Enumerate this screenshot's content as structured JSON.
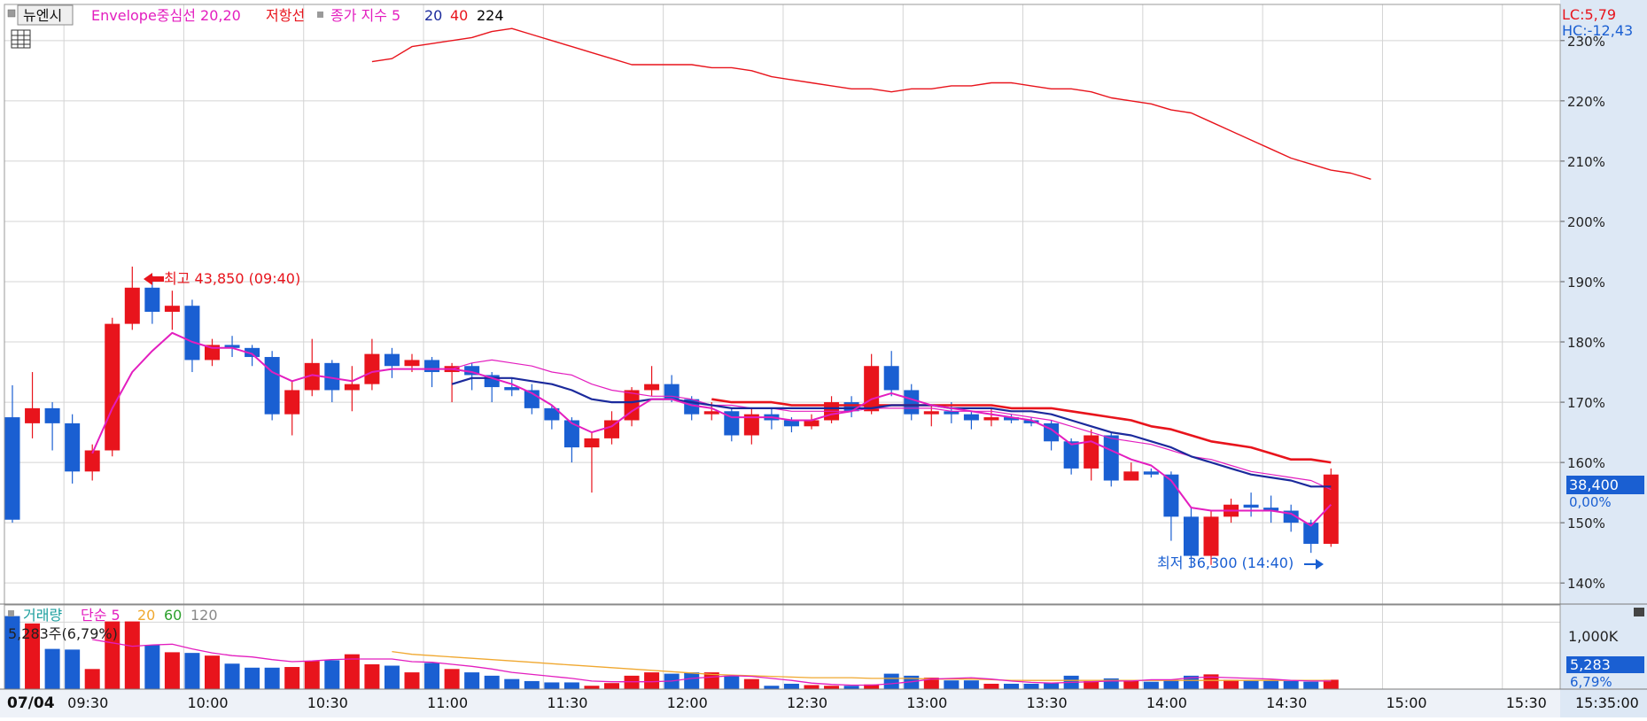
{
  "colors": {
    "up": "#e8141c",
    "down": "#1a5fd2",
    "envelope": "#e31ebf",
    "ma5": "#e31ebf",
    "ma20": "#1b2a9c",
    "ma40": "#e8141c",
    "ma224": "#000000",
    "upper_band": "#e8141c",
    "vol5": "#e31ebf",
    "vol20": "#f0a830",
    "vol60": "#2ca02c",
    "vol120": "#888888",
    "axis_panel": "#dde8f5",
    "grid": "#d4d4d4"
  },
  "header": {
    "btn_label": "뉴엔시",
    "indicator_name": "Envelope중심선 20,20",
    "resistance_label": "저항선",
    "ma_name": "종가 지수 5",
    "ma20_label": "20",
    "ma40_label": "40",
    "ma224_label": "224",
    "lc_label": "LC:5,79",
    "hc_label": "HC:-12,43"
  },
  "annotations": {
    "high_label": "최고 43,850 (09:40)",
    "low_label": "최저 36,300 (14:40)",
    "last_price": "38,400",
    "last_pct": "0,00%"
  },
  "volume_header": {
    "name": "거래량",
    "type": "단순 5",
    "p20": "20",
    "p60": "60",
    "p120": "120",
    "current": "5,283주(6,79%)",
    "last_value": "5,283",
    "last_pct": "6,79%",
    "axis_label": "1,000K"
  },
  "footer": {
    "date_label": "07/04",
    "end_time": "15:35:00"
  },
  "chart_data": {
    "type": "candlestick",
    "x_labels": [
      "09:30",
      "10:00",
      "10:30",
      "11:00",
      "11:30",
      "12:00",
      "12:30",
      "13:00",
      "13:30",
      "14:00",
      "14:30",
      "15:00",
      "15:30"
    ],
    "y_tick_labels": [
      "140%",
      "150%",
      "160%",
      "170%",
      "180%",
      "190%",
      "200%",
      "210%",
      "220%",
      "230%"
    ],
    "y_tick_values": [
      140,
      150,
      160,
      170,
      180,
      190,
      200,
      210,
      220,
      230
    ],
    "ylim": [
      136.5,
      236
    ],
    "grid": true,
    "candles": [
      [
        167.5,
        150.5,
        172.8,
        150
      ],
      [
        166.5,
        169,
        175,
        164
      ],
      [
        169,
        166.5,
        170,
        162
      ],
      [
        166.5,
        158.5,
        168,
        156.5
      ],
      [
        158.5,
        162,
        163,
        157
      ],
      [
        162,
        183,
        184,
        161
      ],
      [
        183,
        189,
        192.5,
        182
      ],
      [
        189,
        185,
        191,
        183
      ],
      [
        185,
        186,
        188.5,
        182
      ],
      [
        186,
        177,
        187,
        175
      ],
      [
        177,
        179.5,
        180.5,
        176
      ],
      [
        179.5,
        179,
        181,
        177.5
      ],
      [
        179,
        177.5,
        179.5,
        176
      ],
      [
        177.5,
        168,
        178.5,
        167
      ],
      [
        168,
        172,
        173.5,
        164.5
      ],
      [
        172,
        176.5,
        180.5,
        171
      ],
      [
        176.5,
        172,
        177,
        170
      ],
      [
        172,
        173,
        176,
        168.5
      ],
      [
        173,
        178,
        180.5,
        172
      ],
      [
        178,
        176,
        179,
        174
      ],
      [
        176,
        177,
        178,
        175
      ],
      [
        177,
        175,
        177.5,
        172.5
      ],
      [
        175,
        176,
        176.5,
        170
      ],
      [
        176,
        174.5,
        176.5,
        172
      ],
      [
        174.5,
        172.5,
        175,
        170
      ],
      [
        172.5,
        172,
        174,
        171
      ],
      [
        172,
        169,
        173,
        168
      ],
      [
        169,
        167,
        169.5,
        165.5
      ],
      [
        167,
        162.5,
        167.5,
        160
      ],
      [
        162.5,
        164,
        165,
        155
      ],
      [
        164,
        167,
        168.5,
        163
      ],
      [
        167,
        172,
        172.5,
        166
      ],
      [
        172,
        173,
        176,
        171
      ],
      [
        173,
        170.5,
        174.5,
        170
      ],
      [
        170.5,
        168,
        171,
        167
      ],
      [
        168,
        168.5,
        170,
        167
      ],
      [
        168.5,
        164.5,
        169,
        163.5
      ],
      [
        164.5,
        168,
        169,
        163
      ],
      [
        168,
        167,
        169,
        165.5
      ],
      [
        167,
        166,
        167.5,
        165
      ],
      [
        166,
        167,
        168,
        165.5
      ],
      [
        167,
        170,
        171,
        166.5
      ],
      [
        170,
        168.5,
        171,
        167.5
      ],
      [
        168.5,
        176,
        178,
        168
      ],
      [
        176,
        172,
        178.5,
        171
      ],
      [
        172,
        168,
        173,
        167
      ],
      [
        168,
        168.5,
        169.5,
        166
      ],
      [
        168.5,
        168,
        170,
        166.5
      ],
      [
        168,
        167,
        168.5,
        165.5
      ],
      [
        167,
        167.5,
        169,
        166
      ],
      [
        167.5,
        167,
        168,
        166.5
      ],
      [
        167,
        166.5,
        167.5,
        166
      ],
      [
        166.5,
        163.5,
        167,
        162
      ],
      [
        163.5,
        159,
        164,
        158
      ],
      [
        159,
        164.5,
        165.5,
        157
      ],
      [
        164.5,
        157,
        165,
        156
      ],
      [
        157,
        158.5,
        160,
        157
      ],
      [
        158.5,
        158,
        159,
        157.5
      ],
      [
        158,
        151,
        158.5,
        147
      ],
      [
        151,
        144.5,
        152.5,
        142.5
      ],
      [
        144.5,
        151,
        152,
        143
      ],
      [
        151,
        153,
        154,
        150
      ],
      [
        153,
        152.5,
        155,
        151
      ],
      [
        152.5,
        152,
        154.5,
        150
      ],
      [
        152,
        150,
        153,
        148.5
      ],
      [
        150,
        146.5,
        150.5,
        145
      ],
      [
        146.5,
        158,
        159,
        146
      ]
    ],
    "ma5": [
      null,
      null,
      null,
      null,
      161.5,
      169,
      175,
      178.5,
      181.5,
      180,
      179,
      179,
      178,
      175,
      173.5,
      174.5,
      174,
      173.5,
      175,
      175.5,
      175.5,
      175.5,
      175.5,
      175,
      174,
      173,
      171.5,
      169.5,
      166.5,
      165,
      166,
      168.5,
      170.5,
      170.5,
      169.5,
      169,
      167.5,
      167.5,
      167.5,
      167,
      167,
      168,
      168.5,
      170.5,
      171.5,
      170.5,
      169.5,
      169,
      168.5,
      168,
      167.5,
      167,
      165.5,
      163,
      163.5,
      162,
      160.5,
      159.5,
      157,
      152.5,
      152,
      152,
      152,
      152,
      151.5,
      149.5,
      153
    ],
    "ma20": [
      null,
      null,
      null,
      null,
      null,
      null,
      null,
      null,
      null,
      null,
      null,
      null,
      null,
      null,
      null,
      null,
      null,
      null,
      null,
      null,
      null,
      null,
      173,
      174,
      174,
      174,
      173.5,
      173,
      172,
      170.5,
      170,
      170,
      170.5,
      170.5,
      170,
      169.5,
      169,
      169,
      169,
      169,
      169,
      169,
      169,
      169,
      169.5,
      169.5,
      169.5,
      169,
      169,
      169,
      168.5,
      168.5,
      168,
      167,
      166,
      165,
      164.5,
      163.5,
      162.5,
      161,
      160,
      159,
      158,
      157.5,
      157,
      156,
      156
    ],
    "ma40": [
      null,
      null,
      null,
      null,
      null,
      null,
      null,
      null,
      null,
      null,
      null,
      null,
      null,
      null,
      null,
      null,
      null,
      null,
      null,
      null,
      null,
      null,
      null,
      null,
      null,
      null,
      null,
      null,
      null,
      null,
      null,
      null,
      null,
      null,
      null,
      170.5,
      170,
      170,
      170,
      169.5,
      169.5,
      169.5,
      169.5,
      169.5,
      169.5,
      169.5,
      169.5,
      169.5,
      169.5,
      169.5,
      169,
      169,
      169,
      168.5,
      168,
      167.5,
      167,
      166,
      165.5,
      164.5,
      163.5,
      163,
      162.5,
      161.5,
      160.5,
      160.5,
      160
    ],
    "envelope_mid": [
      null,
      null,
      null,
      null,
      null,
      null,
      null,
      null,
      null,
      null,
      null,
      null,
      null,
      null,
      null,
      null,
      null,
      null,
      null,
      null,
      null,
      null,
      175.5,
      176.5,
      177,
      176.5,
      176,
      175,
      174.5,
      173,
      172,
      171.5,
      171,
      171,
      170.5,
      169.5,
      169.5,
      169,
      169,
      168.5,
      168.5,
      168.5,
      168.5,
      169,
      169,
      169,
      169,
      168.5,
      168.5,
      168.5,
      168,
      167.5,
      167,
      166,
      165,
      164,
      163.5,
      163,
      162,
      161,
      160.5,
      159.5,
      158.5,
      158,
      157.5,
      157,
      155.5
    ],
    "resistance": [
      null,
      null,
      null,
      null,
      null,
      null,
      null,
      null,
      null,
      null,
      null,
      null,
      null,
      null,
      null,
      null,
      null,
      null,
      226.5,
      227,
      229,
      229.5,
      230,
      230.5,
      231.5,
      232,
      231,
      230,
      229,
      228,
      227,
      226,
      226,
      226,
      226,
      225.5,
      225.5,
      225,
      224,
      223.5,
      223,
      222.5,
      222,
      222,
      221.5,
      222,
      222,
      222.5,
      222.5,
      223,
      223,
      222.5,
      222,
      222,
      221.5,
      220.5,
      220,
      219.5,
      218.5,
      218,
      216.5,
      215,
      213.5,
      212,
      210.5,
      209.5,
      208.5,
      208,
      207
    ],
    "volume": {
      "values": [
        1090,
        980,
        600,
        590,
        300,
        1010,
        1010,
        660,
        550,
        540,
        500,
        380,
        320,
        320,
        330,
        420,
        430,
        520,
        370,
        350,
        250,
        390,
        300,
        250,
        200,
        150,
        120,
        100,
        100,
        50,
        90,
        200,
        250,
        230,
        250,
        250,
        200,
        150,
        50,
        80,
        60,
        50,
        50,
        70,
        230,
        200,
        170,
        130,
        130,
        80,
        80,
        80,
        90,
        200,
        120,
        160,
        120,
        110,
        140,
        200,
        220,
        140,
        130,
        130,
        120,
        110,
        140
      ],
      "ylim": [
        0,
        1150
      ],
      "tick_values": [
        1000
      ],
      "ma5": [
        null,
        null,
        null,
        null,
        740,
        690,
        640,
        660,
        670,
        600,
        540,
        500,
        480,
        440,
        410,
        420,
        440,
        450,
        450,
        450,
        410,
        400,
        370,
        340,
        300,
        250,
        220,
        190,
        160,
        120,
        110,
        110,
        110,
        120,
        160,
        180,
        200,
        190,
        160,
        130,
        90,
        70,
        60,
        60,
        80,
        110,
        150,
        160,
        170,
        150,
        120,
        100,
        90,
        100,
        110,
        120,
        120,
        140,
        140,
        170,
        180,
        170,
        160,
        150,
        130,
        120,
        120
      ],
      "ma20": [
        null,
        null,
        null,
        null,
        null,
        null,
        null,
        null,
        null,
        null,
        null,
        null,
        null,
        null,
        null,
        null,
        null,
        null,
        null,
        560,
        520,
        500,
        480,
        460,
        440,
        420,
        400,
        380,
        360,
        340,
        320,
        300,
        280,
        260,
        240,
        220,
        210,
        200,
        190,
        180,
        170,
        170,
        170,
        160,
        160,
        160,
        150,
        150,
        150,
        140,
        130,
        130,
        130,
        130,
        130,
        130,
        130,
        130,
        130,
        130,
        130,
        130,
        130,
        130,
        130,
        130,
        130
      ],
      "ma60": [
        null,
        null,
        null,
        null,
        null,
        null,
        null,
        null,
        null,
        null,
        null,
        null,
        null,
        null,
        null,
        null,
        null,
        null,
        null,
        null,
        null,
        null,
        null,
        null,
        null,
        null,
        null,
        null,
        null,
        null,
        null,
        null,
        null,
        null,
        null,
        null,
        null,
        null,
        null,
        null,
        null,
        null,
        null,
        null,
        null,
        null,
        null,
        null,
        null,
        null,
        null,
        null,
        null,
        null,
        null,
        null,
        null,
        null,
        null,
        null,
        null,
        null,
        null,
        null,
        null,
        null,
        null
      ]
    }
  }
}
